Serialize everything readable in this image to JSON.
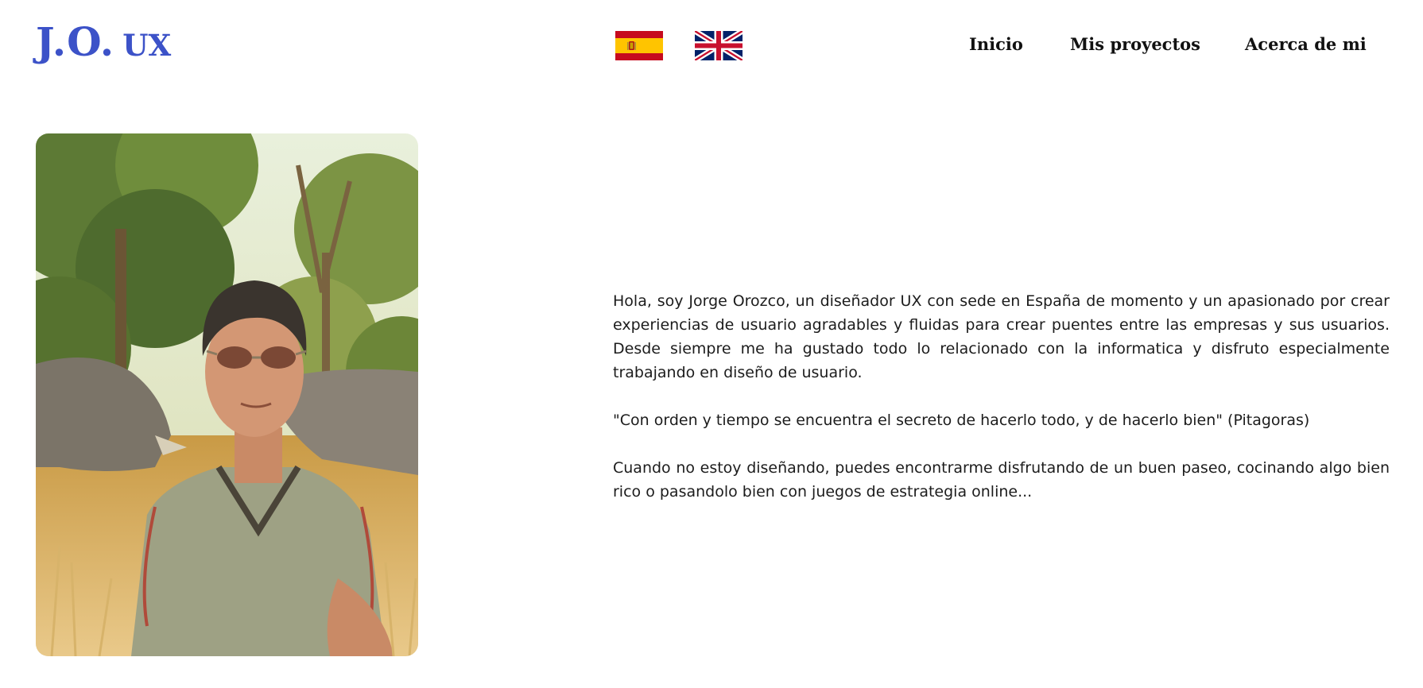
{
  "header": {
    "logo": {
      "initials": "J.O.",
      "suffix": "UX",
      "color": "#3c52c8"
    },
    "languages": [
      {
        "name": "spain-flag-icon",
        "code": "es"
      },
      {
        "name": "uk-flag-icon",
        "code": "en"
      }
    ],
    "nav": {
      "inicio": "Inicio",
      "proyectos": "Mis proyectos",
      "acerca": "Acerca de mi"
    }
  },
  "main": {
    "photo": {
      "icon": "profile-photo"
    },
    "bio": {
      "intro": "Hola, soy Jorge Orozco, un diseñador UX con sede en España de momento y un apasionado por crear experiencias de usuario agradables y fluidas para crear puentes entre las empresas y sus usuarios. Desde siempre me ha gustado todo lo relacionado con la informatica y disfruto especialmente trabajando en diseño de usuario.",
      "quote": "\"Con orden y tiempo se encuentra el secreto de hacerlo todo, y de hacerlo bien\" (Pitagoras)",
      "hobbies": "Cuando no estoy diseñando, puedes encontrarme disfrutando de un buen paseo, cocinando algo bien rico o pasandolo bien con juegos de estrategia online..."
    }
  }
}
